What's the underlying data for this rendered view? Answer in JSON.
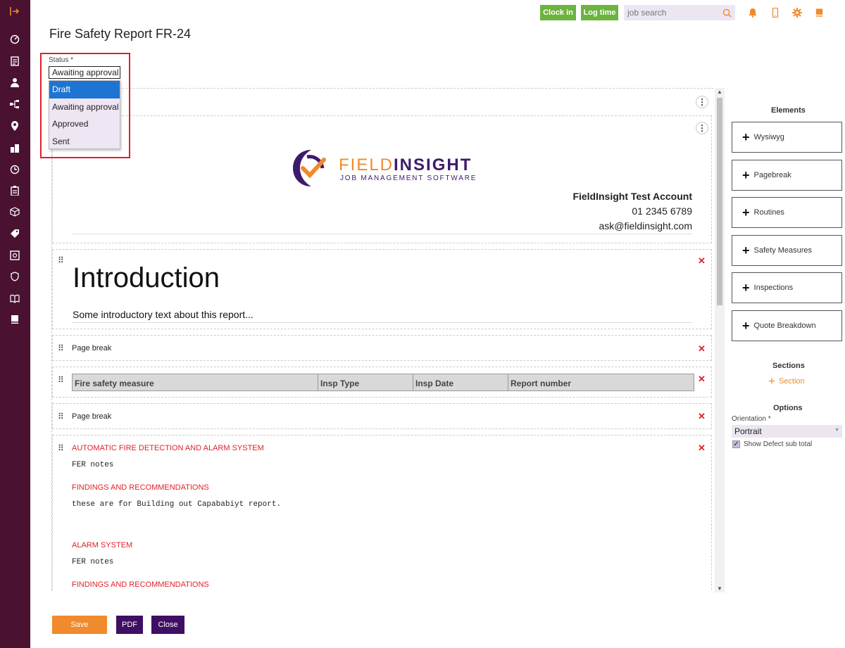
{
  "sidebar": {
    "items": [
      {
        "icon": "logout-icon"
      },
      {
        "icon": "gauge-icon"
      },
      {
        "icon": "document-icon"
      },
      {
        "icon": "user-icon"
      },
      {
        "icon": "hierarchy-icon"
      },
      {
        "icon": "location-pin-icon"
      },
      {
        "icon": "buildings-icon"
      },
      {
        "icon": "clock-icon"
      },
      {
        "icon": "clipboard-icon"
      },
      {
        "icon": "box-icon"
      },
      {
        "icon": "tag-icon"
      },
      {
        "icon": "safe-icon"
      },
      {
        "icon": "shield-icon"
      },
      {
        "icon": "book-icon"
      },
      {
        "icon": "book-closed-icon"
      }
    ]
  },
  "topbar": {
    "clock_in_label": "Clock in",
    "log_time_label": "Log time",
    "search_placeholder": "job search",
    "icons": [
      "search-icon",
      "bell-icon",
      "mobile-icon",
      "gear-icon",
      "book-icon"
    ]
  },
  "page": {
    "title": "Fire Safety Report FR-24"
  },
  "status": {
    "label": "Status *",
    "value": "Awaiting approval",
    "options": [
      "Draft",
      "Awaiting approval",
      "Approved",
      "Sent"
    ],
    "highlighted_option": "Draft"
  },
  "header_block": {
    "logo_field": "FIELD",
    "logo_insight": "INSIGHT",
    "logo_subtitle": "JOB MANAGEMENT SOFTWARE",
    "company_name": "FieldInsight Test Account",
    "phone": "01 2345 6789",
    "email": "ask@fieldinsight.com"
  },
  "intro_block": {
    "heading": "Introduction",
    "text": "Some introductory text about this report..."
  },
  "pagebreak_label": "Page break",
  "table_block": {
    "columns": [
      "Fire safety measure",
      "Insp Type",
      "Insp Date",
      "Report number"
    ]
  },
  "sections_block": {
    "items": [
      {
        "heading": "AUTOMATIC FIRE DETECTION AND ALARM SYSTEM",
        "text": "FER notes"
      },
      {
        "heading": "FINDINGS AND RECOMMENDATIONS",
        "text": "these are for Building out Capababiyt report."
      },
      {
        "heading": "ALARM SYSTEM",
        "text": "FER notes"
      },
      {
        "heading": "FINDINGS AND RECOMMENDATIONS",
        "text": ""
      }
    ]
  },
  "right_panel": {
    "elements_title": "Elements",
    "elements": [
      "Wysiwyg",
      "Pagebreak",
      "Routines",
      "Safety Measures",
      "Inspections",
      "Quote Breakdown"
    ],
    "sections_title": "Sections",
    "section_button": "Section",
    "options_title": "Options",
    "orientation_label": "Orientation *",
    "orientation_value": "Portrait",
    "show_defect_label": "Show Defect sub total",
    "show_defect_checked": true
  },
  "footer": {
    "save_label": "Save",
    "pdf_label": "PDF",
    "close_label": "Close"
  },
  "colors": {
    "sidebar": "#4a1230",
    "accent_orange": "#f08a2c",
    "green": "#6db33f",
    "purple": "#3f0f63",
    "red": "#e0202a"
  }
}
